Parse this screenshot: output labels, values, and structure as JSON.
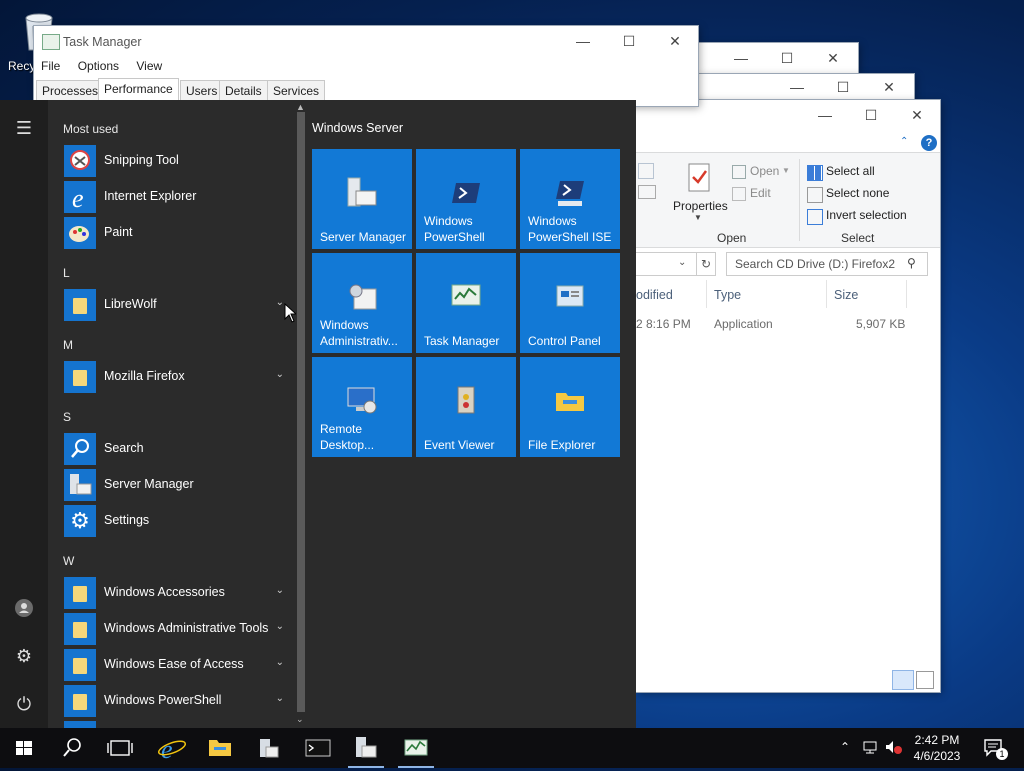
{
  "desktop": {
    "recycle_label": "Recy"
  },
  "task_manager": {
    "title": "Task Manager",
    "menu": [
      "File",
      "Options",
      "View"
    ],
    "tabs": [
      "Processes",
      "Performance",
      "Users",
      "Details",
      "Services"
    ],
    "active_tab": "Performance"
  },
  "explorer": {
    "ribbon": {
      "properties": "Properties",
      "open": "Open",
      "edit": "Edit",
      "open_group": "Open",
      "select_all": "Select all",
      "select_none": "Select none",
      "invert_selection": "Invert selection",
      "select_group": "Select"
    },
    "search_placeholder": "Search CD Drive (D:) Firefox2",
    "columns": [
      "odified",
      "Type",
      "Size"
    ],
    "row": {
      "modified": "2 8:16 PM",
      "type": "Application",
      "size": "5,907 KB"
    }
  },
  "start_menu": {
    "most_used_label": "Most used",
    "most_used": [
      {
        "label": "Snipping Tool"
      },
      {
        "label": "Internet Explorer"
      },
      {
        "label": "Paint"
      }
    ],
    "groups": [
      {
        "letter": "L",
        "apps": [
          {
            "label": "LibreWolf",
            "folder": true
          }
        ]
      },
      {
        "letter": "M",
        "apps": [
          {
            "label": "Mozilla Firefox",
            "folder": true
          }
        ]
      },
      {
        "letter": "S",
        "apps": [
          {
            "label": "Search"
          },
          {
            "label": "Server Manager"
          },
          {
            "label": "Settings"
          }
        ]
      },
      {
        "letter": "W",
        "apps": [
          {
            "label": "Windows Accessories",
            "folder": true
          },
          {
            "label": "Windows Administrative Tools",
            "folder": true
          },
          {
            "label": "Windows Ease of Access",
            "folder": true
          },
          {
            "label": "Windows PowerShell",
            "folder": true
          }
        ]
      }
    ],
    "tiles_header": "Windows Server",
    "tiles": [
      {
        "label1": "Server Manager",
        "label2": ""
      },
      {
        "label1": "Windows",
        "label2": "PowerShell"
      },
      {
        "label1": "Windows",
        "label2": "PowerShell ISE"
      },
      {
        "label1": "Windows",
        "label2": "Administrativ..."
      },
      {
        "label1": "Task Manager",
        "label2": ""
      },
      {
        "label1": "Control Panel",
        "label2": ""
      },
      {
        "label1": "Remote",
        "label2": "Desktop..."
      },
      {
        "label1": "Event Viewer",
        "label2": ""
      },
      {
        "label1": "File Explorer",
        "label2": ""
      }
    ]
  },
  "taskbar": {
    "time": "2:42 PM",
    "date": "4/6/2023",
    "notification_count": "1"
  },
  "colors": {
    "tile_blue": "#1279d6",
    "start_bg": "#2b2b2b",
    "taskbar_bg": "#0d0d10"
  }
}
